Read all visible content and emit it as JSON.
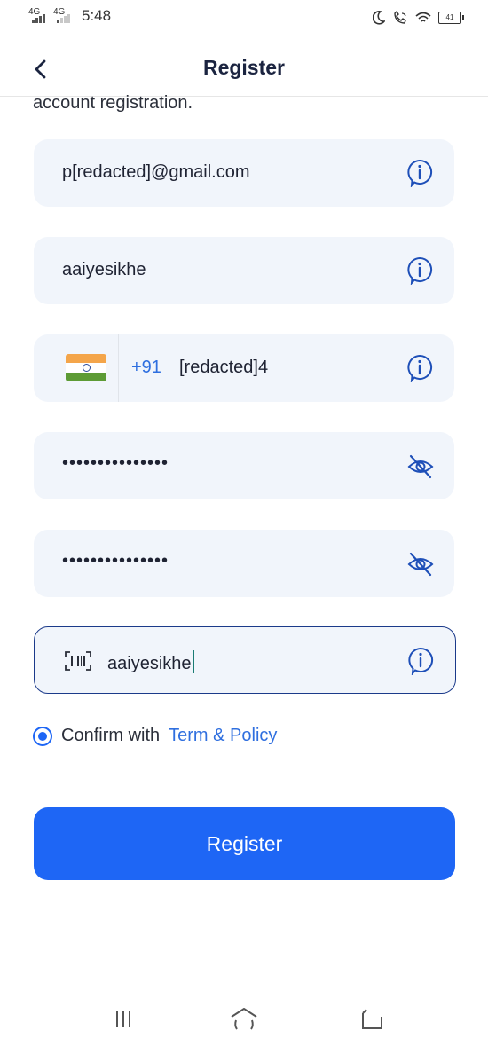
{
  "status_bar": {
    "net1": "4G",
    "net2": "4G",
    "time": "5:48",
    "battery": "41"
  },
  "header": {
    "title": "Register"
  },
  "subtitle": "account registration.",
  "fields": {
    "email_value": "p[redacted]@gmail.com",
    "username_value": "aaiyesikhe",
    "phone_code": "+91",
    "phone_value": "[redacted]4",
    "password_value": "•••••••••••••••",
    "confirm_password_value": "•••••••••••••••",
    "referral_value": "aaiyesikhe"
  },
  "consent": {
    "text": "Confirm with",
    "link": "Term & Policy"
  },
  "register_button_label": "Register",
  "colors": {
    "accent": "#1e66f5",
    "field_bg": "#f1f5fb",
    "title": "#1b2440"
  }
}
